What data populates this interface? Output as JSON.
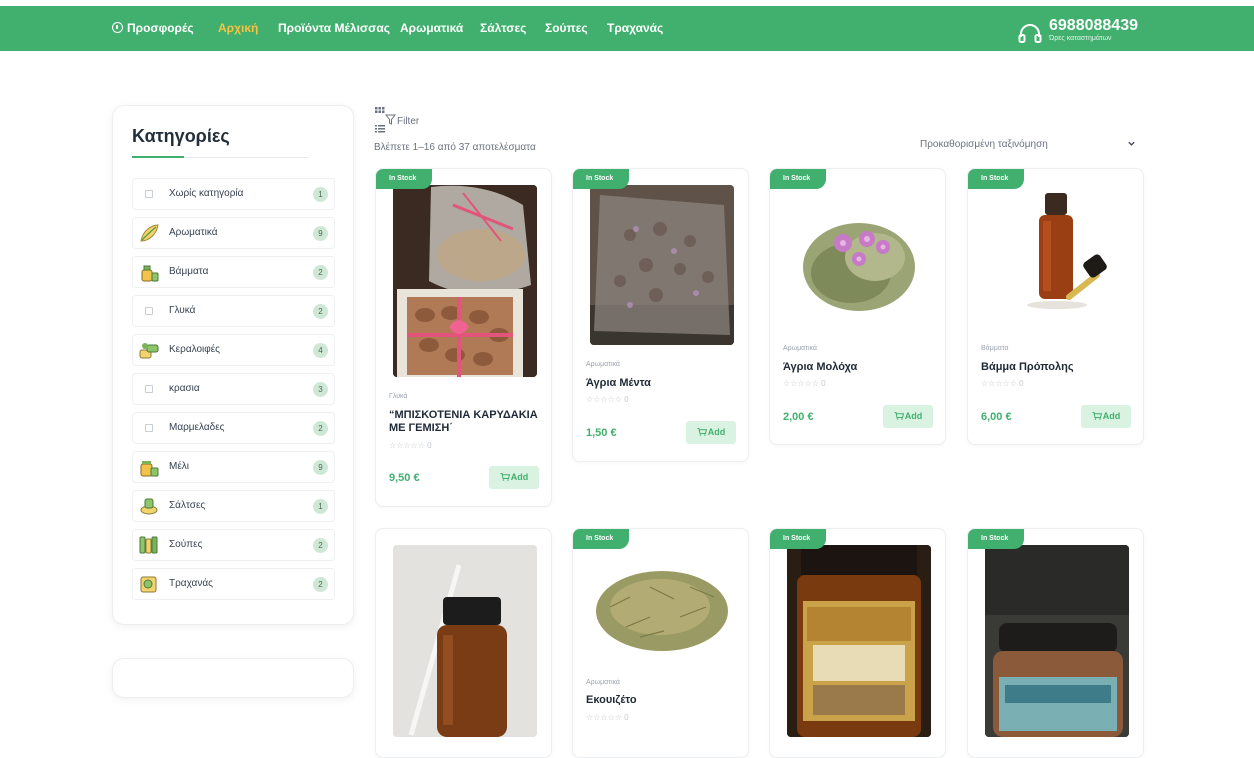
{
  "nav": {
    "items": [
      {
        "label": "Προσφορές"
      },
      {
        "label": "Αρχική"
      },
      {
        "label": "Προϊόντα Μέλισσας"
      },
      {
        "label": "Αρωματικά"
      },
      {
        "label": "Σάλτσες"
      },
      {
        "label": "Σούπες"
      },
      {
        "label": "Τραχανάς"
      }
    ],
    "active_index": 1,
    "phone": "6988088439",
    "phone_sub": "Ώρες καταστημάτων"
  },
  "sidebar": {
    "title": "Κατηγορίες",
    "categories": [
      {
        "label": "Χωρίς κατηγορία",
        "count": "1",
        "icon": "image-placeholder-icon"
      },
      {
        "label": "Αρωματικά",
        "count": "9",
        "icon": "herbs-icon"
      },
      {
        "label": "Βάμματα",
        "count": "2",
        "icon": "tincture-icon"
      },
      {
        "label": "Γλυκά",
        "count": "2",
        "icon": "image-placeholder-icon"
      },
      {
        "label": "Κεραλοιφές",
        "count": "4",
        "icon": "ointment-icon"
      },
      {
        "label": "κρασια",
        "count": "3",
        "icon": "image-placeholder-icon"
      },
      {
        "label": "Μαρμελαδες",
        "count": "2",
        "icon": "image-placeholder-icon"
      },
      {
        "label": "Μέλι",
        "count": "9",
        "icon": "honey-icon"
      },
      {
        "label": "Σάλτσες",
        "count": "1",
        "icon": "sauce-icon"
      },
      {
        "label": "Σούπες",
        "count": "2",
        "icon": "soup-icon"
      },
      {
        "label": "Τραχανάς",
        "count": "2",
        "icon": "trahanas-icon"
      }
    ]
  },
  "toolbar": {
    "filter_label": "Filter",
    "results_text": "Βλέπετε 1–16 από 37 αποτελέσματα",
    "sort_label": "Προκαθορισμένη ταξινόμηση"
  },
  "products": [
    {
      "badge": "In Stock",
      "category": "Γλυκά",
      "name": "“ΜΠΙΣΚΟΤΕΝΙΑ ΚΑΡΥΔΑΚΙΑ ΜΕ ΓΕΜΙΣΗ΄",
      "stars": "☆☆☆☆☆",
      "rating_count": "0",
      "price": "9,50 €",
      "add_label": "Add",
      "rating": 0
    },
    {
      "badge": "In Stock",
      "category": "Αρωματικά",
      "name": "Άγρια Μέντα",
      "stars": "☆☆☆☆☆",
      "rating_count": "0",
      "price": "1,50 €",
      "add_label": "Add",
      "rating": 0
    },
    {
      "badge": "In Stock",
      "category": "Αρωματικά",
      "name": "Άγρια Μολόχα",
      "stars": "☆☆☆☆☆",
      "rating_count": "0",
      "price": "2,00 €",
      "add_label": "Add",
      "rating": 0
    },
    {
      "badge": "In Stock",
      "category": "Βάμματα",
      "name": "Βάμμα Πρόπολης",
      "stars": "☆☆☆☆☆",
      "rating_count": "0",
      "price": "6,00 €",
      "add_label": "Add",
      "rating": 0
    },
    {
      "badge": "",
      "category": "",
      "name": "",
      "stars": "",
      "rating_count": "",
      "price": "",
      "add_label": ""
    },
    {
      "badge": "In Stock",
      "category": "Αρωματικά",
      "name": "Εκουιζέτο",
      "stars": "☆☆☆☆☆",
      "rating_count": "0",
      "price": "",
      "add_label": ""
    },
    {
      "badge": "In Stock",
      "category": "",
      "name": "",
      "stars": "",
      "rating_count": "",
      "price": "",
      "add_label": ""
    },
    {
      "badge": "In Stock",
      "category": "",
      "name": "",
      "stars": "",
      "rating_count": "",
      "price": "",
      "add_label": ""
    }
  ],
  "colors": {
    "brand_green": "#41b06e",
    "active_nav": "#f6c344",
    "badge_bg": "#cfe8d6",
    "add_bg": "#daf2e2"
  }
}
